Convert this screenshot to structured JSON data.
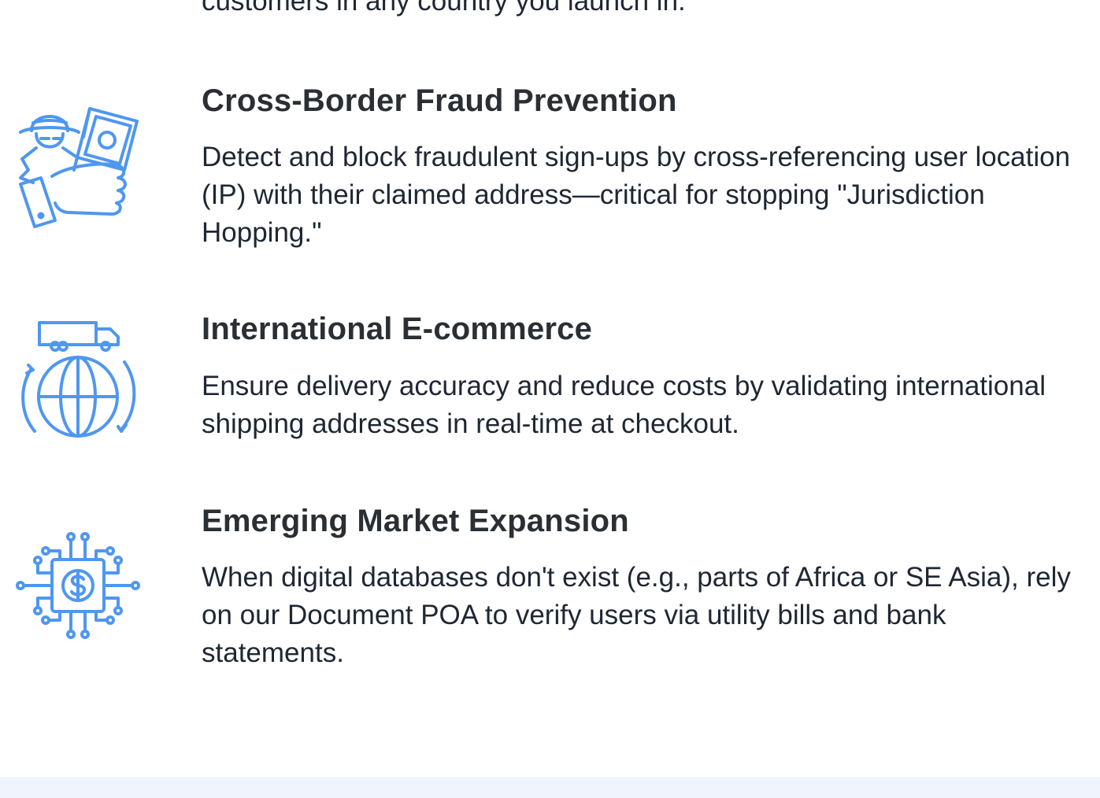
{
  "partial_item": {
    "desc_tail": "customers in any country you launch in.",
    "icon": "globe-partial-icon"
  },
  "features": [
    {
      "title": "Cross-Border Fraud Prevention",
      "description": "Detect and block fraudulent sign-ups by cross-referencing user location (IP) with their claimed address—critical for stopping \"Jurisdiction Hopping.\"",
      "icon": "fraud-thief-money-hand-icon"
    },
    {
      "title": "International E-commerce",
      "description": "Ensure delivery accuracy and reduce costs by validating international shipping addresses in real-time at checkout.",
      "icon": "truck-globe-shipping-icon"
    },
    {
      "title": "Emerging Market Expansion",
      "description": "When digital databases don't exist (e.g., parts of Africa or SE Asia), rely on our Document POA to verify users via utility bills and bank statements.",
      "icon": "dollar-chip-circuit-icon"
    }
  ],
  "colors": {
    "icon_blue": "#4f97f0",
    "footer_band": "#f0f5fd",
    "title_text": "#2b2f33",
    "body_text": "#1e2733"
  }
}
